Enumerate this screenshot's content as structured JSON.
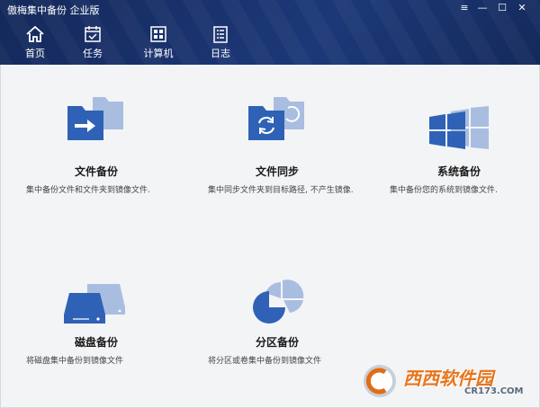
{
  "window": {
    "title": "傲梅集中备份 企业版",
    "controls": [
      "≡",
      "—",
      "☐",
      "✕"
    ]
  },
  "nav": [
    {
      "label": "首页",
      "icon": "home-icon"
    },
    {
      "label": "任务",
      "icon": "task-icon"
    },
    {
      "label": "计算机",
      "icon": "computer-icon"
    },
    {
      "label": "日志",
      "icon": "log-icon"
    }
  ],
  "cards": [
    {
      "title": "文件备份",
      "desc": "集中备份文件和文件夹到镜像文件.",
      "icon": "file-backup-icon"
    },
    {
      "title": "文件同步",
      "desc": "集中同步文件夹到目标路径, 不产生镜像.",
      "icon": "file-sync-icon"
    },
    {
      "title": "系统备份",
      "desc": "集中备份您的系统到镜像文件.",
      "icon": "system-backup-icon"
    },
    {
      "title": "磁盘备份",
      "desc": "将磁盘集中备份到镜像文件",
      "icon": "disk-backup-icon"
    },
    {
      "title": "分区备份",
      "desc": "将分区或卷集中备份到镜像文件",
      "icon": "partition-backup-icon"
    }
  ],
  "colors": {
    "header": "#1b3572",
    "accent_dark": "#2f62b6",
    "accent_light": "#a9bde0"
  },
  "watermark": {
    "main": "西西软件园",
    "sub": "CR173.COM"
  }
}
